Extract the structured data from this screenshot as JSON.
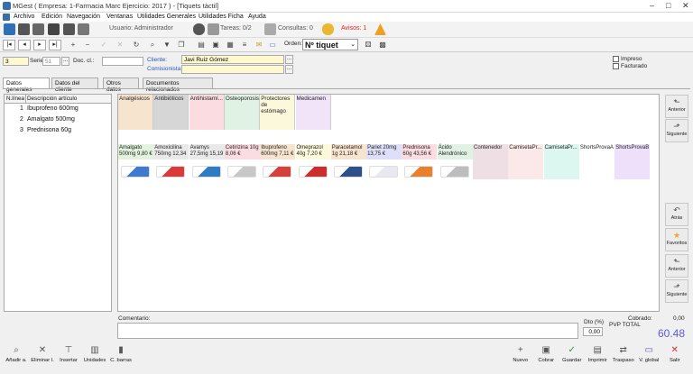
{
  "window": {
    "title": "MGest ( Empresa: 1-Farmacia Marc Ejercicio: 2017 ) - [Tiquets tàctil]"
  },
  "menu": [
    "Archivo",
    "Edición",
    "Navegación",
    "Ventanas",
    "Utilidades Generales",
    "Utilidades Ficha",
    "Ayuda"
  ],
  "toolbar": {
    "user_label": "Usuario: Administrador",
    "tasks": "Tareas: 0/2",
    "consults": "Consultas: 0",
    "alerts": "Avisos: 1"
  },
  "order": {
    "label": "Orden:",
    "value": "Nº tiquet"
  },
  "form": {
    "number": "3",
    "serie_label": "Serie:",
    "serie": "51",
    "doc_label": "Doc. cl.:",
    "doc_value": "",
    "client_label": "Cliente:",
    "client": "Javi Ruiz Gómez",
    "commission_label": "Comisionista:",
    "commission": "",
    "printed": "Impreso",
    "invoiced": "Facturado"
  },
  "tabs": [
    "Datos generales",
    "Datos del cliente",
    "Otros datos",
    "Documentos relacionados"
  ],
  "lines": {
    "headers": [
      "N.línea",
      "Descripción artículo"
    ],
    "rows": [
      {
        "n": "1",
        "desc": "Ibuprofeno 600mg"
      },
      {
        "n": "2",
        "desc": "Amalgato 500mg"
      },
      {
        "n": "3",
        "desc": "Prednisona 60g"
      }
    ]
  },
  "categories": [
    {
      "name": "Analgésicos",
      "color": "#f7e4cf"
    },
    {
      "name": "Antibióticos",
      "color": "#d6d6d6"
    },
    {
      "name": "Antihistamí...",
      "color": "#fbdde1"
    },
    {
      "name": "Osteoporosis",
      "color": "#e0f2e4"
    },
    {
      "name": "Protectores de estómago",
      "color": "#fbf8dc"
    },
    {
      "name": "Medicamen",
      "color": "#f1e3f8"
    }
  ],
  "products": [
    {
      "name": "Amalgato 500mg 9,80 €",
      "color": "#e2f2dd",
      "img": "#3e7bd0"
    },
    {
      "name": "Amoxicilina 750mg 12,34",
      "color": "#e9e9e9",
      "img": "#d93a3a"
    },
    {
      "name": "Avamys 27,5mg 15,19",
      "color": "#e9e9e9",
      "img": "#2e7dc2"
    },
    {
      "name": "Cetirizina 10g 8,06 €",
      "color": "#fbdde1",
      "img": "#c8c8c8"
    },
    {
      "name": "Ibuprofeno 600mg 7,11 €",
      "color": "#f7e4cf",
      "img": "#d4413a"
    },
    {
      "name": "Omeprazol 40g 7,20 €",
      "color": "#fbf8dc",
      "img": "#cc2d2d"
    },
    {
      "name": "Paracetamol 1g 21,18 €",
      "color": "#f7e4cf",
      "img": "#2d4f8a"
    },
    {
      "name": "Pariet 20mg 13,75 €",
      "color": "#dde0f8",
      "img": "#e8e8f0"
    },
    {
      "name": "Prednisona 60g 43,56 €",
      "color": "#fbdde1",
      "img": "#e8802e"
    },
    {
      "name": "Ácido Alendrónico",
      "color": "#e0f2e4",
      "img": "#bdbdbd"
    },
    {
      "name": "Contenedor",
      "color": "#eedfe4",
      "img": ""
    },
    {
      "name": "CamisetaPr...",
      "color": "#fbe8e8",
      "img": ""
    },
    {
      "name": "CamisetaPr...",
      "color": "#dcf7f0",
      "img": ""
    },
    {
      "name": "ShortsProvaA",
      "color": "#ffffff",
      "img": ""
    },
    {
      "name": "ShortsProvaB",
      "color": "#eee0fa",
      "img": ""
    }
  ],
  "right_buttons": [
    {
      "label": "Anterior",
      "icon": "arrow-left-icon"
    },
    {
      "label": "Siguiente",
      "icon": "arrow-right-icon"
    },
    {
      "label": "Atrás",
      "icon": "back-icon"
    },
    {
      "label": "Favoritos",
      "icon": "star-icon"
    },
    {
      "label": "Anterior",
      "icon": "arrow-left-icon"
    },
    {
      "label": "Siguiente",
      "icon": "arrow-right-icon"
    }
  ],
  "footer": {
    "comment_label": "Comentario:",
    "dto_label": "Dto (%)",
    "dto_value": "0,00",
    "collected_label": "Cobrado:",
    "collected": "0,00",
    "pvp_label": "PVP TOTAL",
    "total": "60.48"
  },
  "bottom_left": [
    {
      "label": "Añadir a.",
      "icon": "search-icon"
    },
    {
      "label": "Eliminar l.",
      "icon": "close-icon"
    },
    {
      "label": "Insertar",
      "icon": "insert-icon"
    },
    {
      "label": "Unidades",
      "icon": "units-icon"
    },
    {
      "label": "C. barras",
      "icon": "barcode-icon"
    }
  ],
  "bottom_right": [
    {
      "label": "Nuevo",
      "icon": "plus-icon"
    },
    {
      "label": "Cobrar",
      "icon": "cash-icon"
    },
    {
      "label": "Guardar",
      "icon": "check-icon"
    },
    {
      "label": "Imprimir",
      "icon": "print-icon"
    },
    {
      "label": "Traspaso",
      "icon": "transfer-icon"
    },
    {
      "label": "V. global",
      "icon": "monitor-icon"
    },
    {
      "label": "Salir",
      "icon": "exit-icon"
    }
  ]
}
